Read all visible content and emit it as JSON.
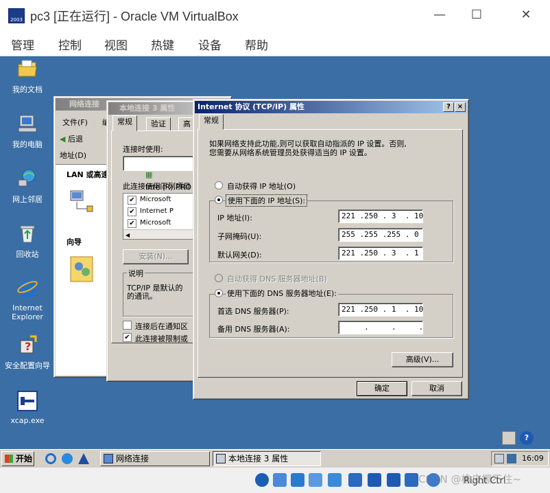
{
  "host": {
    "title": "pc3 [正在运行] - Oracle VM VirtualBox",
    "menu": [
      "管理",
      "控制",
      "视图",
      "热键",
      "设备",
      "帮助"
    ],
    "minimize": "—",
    "maximize": "☐",
    "close": "✕",
    "host_key": "Right Ctrl",
    "watermark": "CSDN @橡皮擦不住~"
  },
  "desktop": {
    "icons": [
      {
        "label": "我的文档"
      },
      {
        "label": "我的电脑"
      },
      {
        "label": "网上邻居"
      },
      {
        "label": "回收站"
      },
      {
        "label": "Internet Explorer"
      },
      {
        "label": "安全配置向导"
      },
      {
        "label": "xcap.exe"
      }
    ]
  },
  "net_window": {
    "title": "网络连接",
    "menu_file": "文件(F)",
    "menu_edit": "编",
    "back": "后退",
    "address_label": "地址(D)",
    "section_lan": "LAN 或高速",
    "section_wizard": "向导"
  },
  "local_props": {
    "title": "本地连接 3 属性",
    "tabs": [
      "常规",
      "验证",
      "高"
    ],
    "connect_using": "连接时使用:",
    "adapter": "Intel(R) PRO",
    "items_label": "此连接使用下列项目",
    "items": [
      "Microsoft",
      "Internet P",
      "Microsoft"
    ],
    "install_button": "安装(N)...",
    "desc_label": "说明",
    "desc_text_1": "TCP/IP 是默认的",
    "desc_text_2": "的通讯。",
    "show_icon": "连接后在通知区",
    "notify_limited": "此连接被限制或"
  },
  "tcpip": {
    "title": "Internet 协议 (TCP/IP) 属性",
    "help": "?",
    "close": "×",
    "tab": "常规",
    "desc_1": "如果网络支持此功能,则可以获取自动指派的 IP 设置。否则,",
    "desc_2": "您需要从网络系统管理员处获得适当的 IP 设置。",
    "auto_ip": "自动获得 IP 地址(O)",
    "manual_ip": "使用下面的 IP 地址(S):",
    "ip_label": "IP 地址(I):",
    "ip_value": "221 .250 . 3  . 10",
    "mask_label": "子网掩码(U):",
    "mask_value": "255 .255 .255 . 0",
    "gw_label": "默认网关(D):",
    "gw_value": "221 .250 . 3  . 1",
    "auto_dns": "自动获得 DNS 服务器地址(B)",
    "manual_dns": "使用下面的 DNS 服务器地址(E):",
    "dns1_label": "首选 DNS 服务器(P):",
    "dns1_value": "221 .250 . 1  . 10",
    "dns2_label": "备用 DNS 服务器(A):",
    "dns2_value": "     .     .     .",
    "advanced": "高级(V)...",
    "ok": "确定",
    "cancel": "取消"
  },
  "taskbar": {
    "start": "开始",
    "tasks": [
      "网络连接",
      "本地连接 3 属性"
    ],
    "clock": "16:09"
  }
}
